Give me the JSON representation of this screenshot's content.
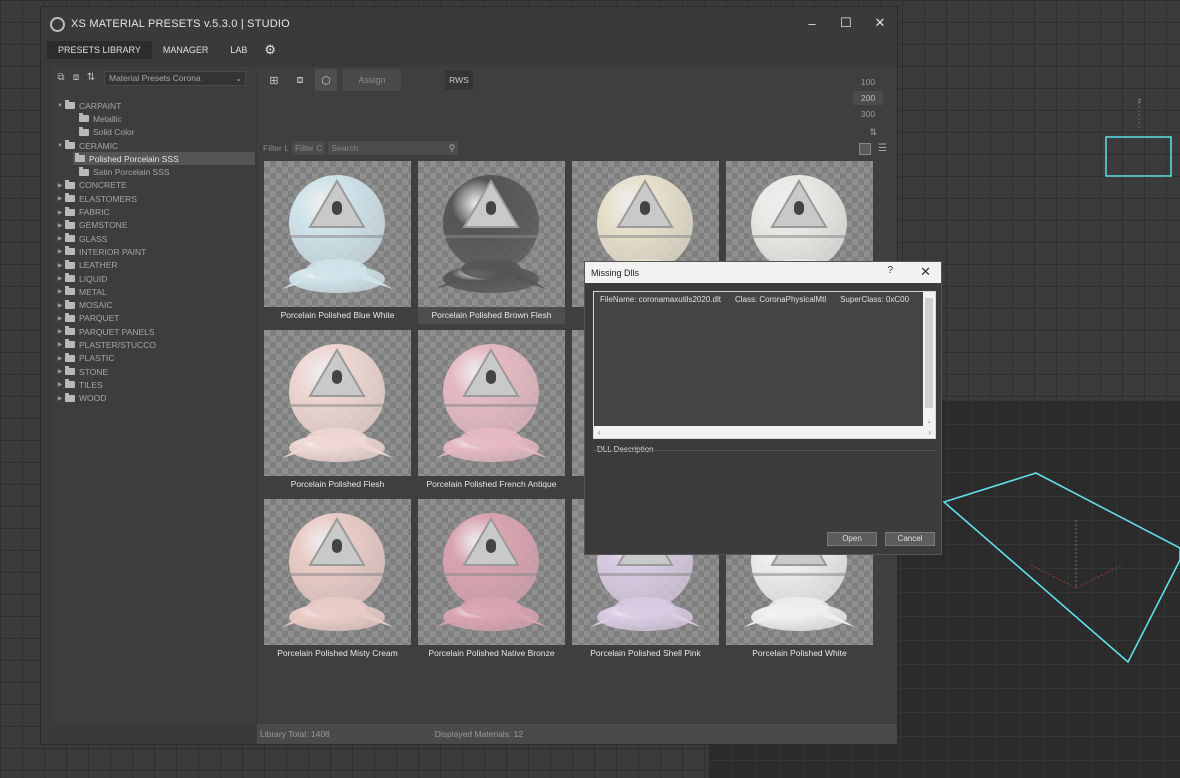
{
  "app": {
    "title": "XS MATERIAL PRESETS v.5.3.0 | STUDIO",
    "window_controls": [
      "–",
      "☐",
      "✕"
    ]
  },
  "menu": [
    {
      "label": "PRESETS LIBRARY",
      "active": true
    },
    {
      "label": "MANAGER",
      "active": false
    },
    {
      "label": "LAB",
      "active": false
    }
  ],
  "sidebar": {
    "library_select": "Material Presets Corona",
    "tree": [
      {
        "label": "CARPAINT",
        "expanded": true,
        "children": [
          "Metallic",
          "Solid Color"
        ]
      },
      {
        "label": "CERAMIC",
        "expanded": true,
        "children": [
          "Polished Porcelain SSS",
          "Satin Porcelain SSS"
        ],
        "selected_child": 0
      },
      {
        "label": "CONCRETE"
      },
      {
        "label": "ELASTOMERS"
      },
      {
        "label": "FABRIC"
      },
      {
        "label": "GEMSTONE"
      },
      {
        "label": "GLASS"
      },
      {
        "label": "INTERIOR PAINT"
      },
      {
        "label": "LEATHER"
      },
      {
        "label": "LIQUID"
      },
      {
        "label": "METAL"
      },
      {
        "label": "MOSAIC"
      },
      {
        "label": "PARQUET"
      },
      {
        "label": "PARQUET PANELS"
      },
      {
        "label": "PLASTER/STUCCO"
      },
      {
        "label": "PLASTIC"
      },
      {
        "label": "STONE"
      },
      {
        "label": "TILES"
      },
      {
        "label": "WOOD"
      }
    ]
  },
  "toolbar": {
    "assign_label": "Assign",
    "rws_label": "RWS",
    "sizes": [
      "100",
      "200",
      "300"
    ],
    "selected_size": "200"
  },
  "filter": {
    "label": "Filter L",
    "filter_button": "Filter C",
    "search_placeholder": "Search"
  },
  "materials": [
    {
      "name": "Porcelain Polished Blue White",
      "color": "#cfe3ea",
      "highlighted": false
    },
    {
      "name": "Porcelain Polished Brown Flesh",
      "color": "#555558",
      "highlighted": true
    },
    {
      "name": "",
      "color": "#e6e0cc",
      "highlighted": false
    },
    {
      "name": "",
      "color": "#e9e9e6",
      "highlighted": false
    },
    {
      "name": "Porcelain Polished Flesh",
      "color": "#eed6d2",
      "highlighted": false
    },
    {
      "name": "Porcelain Polished French Antique",
      "color": "#e5b9c2",
      "highlighted": false
    },
    {
      "name": "",
      "color": "#e5c8cc",
      "highlighted": false
    },
    {
      "name": "",
      "color": "#ececec",
      "highlighted": false
    },
    {
      "name": "Porcelain Polished Misty Cream",
      "color": "#e9cbc6",
      "highlighted": false
    },
    {
      "name": "Porcelain Polished Native Bronze",
      "color": "#d9a3b0",
      "highlighted": false
    },
    {
      "name": "Porcelain Polished Shell Pink",
      "color": "#d8cbe2",
      "highlighted": false
    },
    {
      "name": "Porcelain Polished White",
      "color": "#eeeeee",
      "highlighted": false
    }
  ],
  "status": {
    "library_total": "Library Total: 1408",
    "displayed": "Displayed Materials: 12"
  },
  "dialog": {
    "title": "Missing Dlls",
    "help": "?",
    "close": "✕",
    "row": {
      "filename": "FileName:  coronamaxutils2020.dlt",
      "class": "Class: CoronaPhysicalMtl",
      "superclass": "SuperClass: 0xC00"
    },
    "description_label": "DLL Description",
    "open_label": "Open",
    "cancel_label": "Cancel"
  },
  "colors": {
    "selection_outline": "#5fe0ea",
    "axis_red": "#c0393b"
  }
}
